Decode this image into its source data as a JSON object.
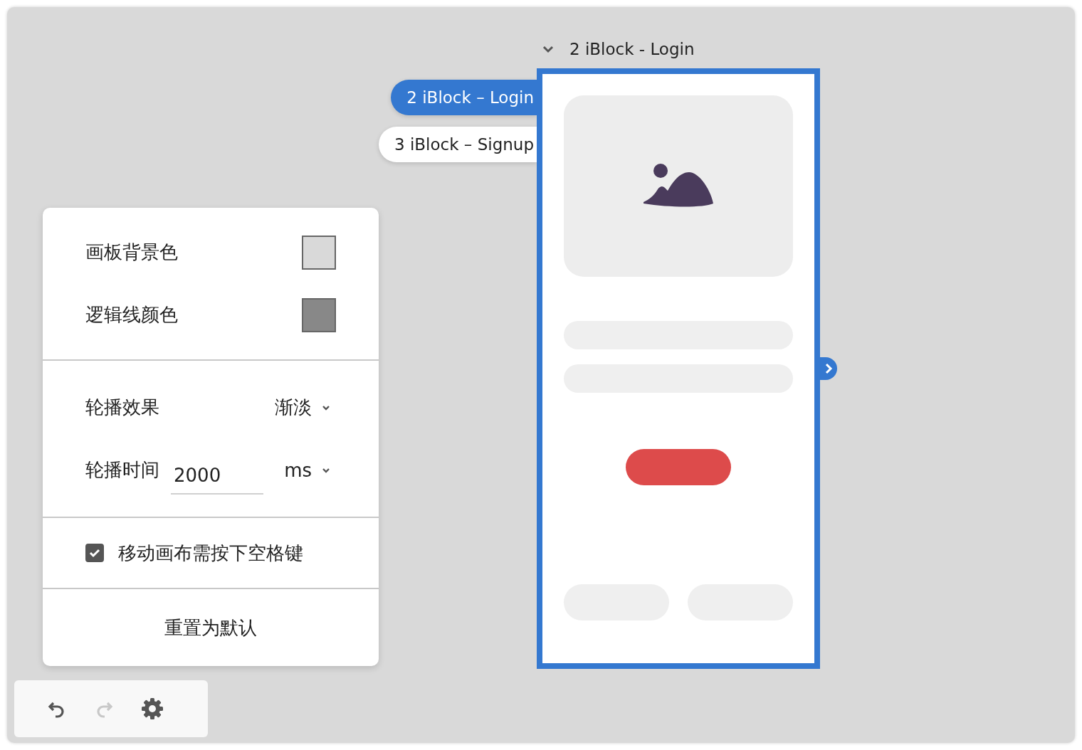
{
  "artboard": {
    "title": "2 iBlock - Login",
    "selected": true
  },
  "pages": [
    {
      "label": "2 iBlock – Login",
      "selected": true
    },
    {
      "label": "3 iBlock – Signup",
      "selected": false
    }
  ],
  "settings": {
    "colors": [
      {
        "label": "画板背景色",
        "color": "#d9d9d9"
      },
      {
        "label": "逻辑线颜色",
        "color": "#888888"
      }
    ],
    "carousel_effect": {
      "label": "轮播效果",
      "value": "渐淡"
    },
    "carousel_time": {
      "label": "轮播时间",
      "value": "2000",
      "unit": "ms"
    },
    "space_to_pan": {
      "label": "移动画布需按下空格键",
      "checked": true
    },
    "reset_button": "重置为默认"
  },
  "toolbar": [
    {
      "kind": "undo",
      "disabled": false
    },
    {
      "kind": "redo",
      "disabled": true
    },
    {
      "kind": "settings",
      "disabled": false
    }
  ]
}
